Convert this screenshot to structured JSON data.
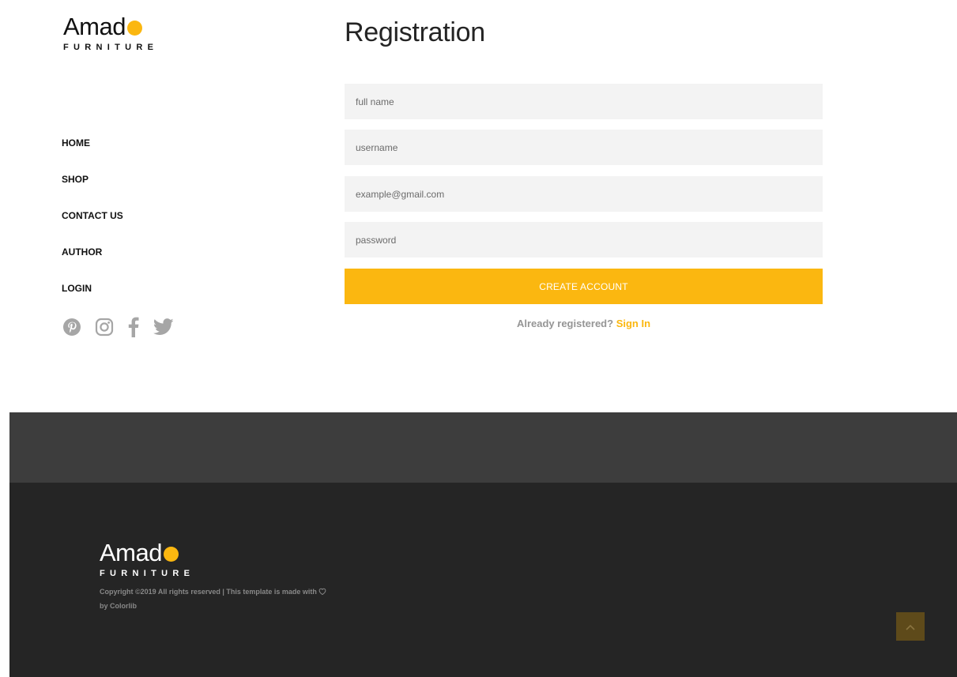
{
  "brand": {
    "name": "Amad",
    "tagline": "FURNITURE",
    "accent_color": "#fbb710"
  },
  "nav": {
    "items": [
      {
        "label": "HOME"
      },
      {
        "label": "SHOP"
      },
      {
        "label": "CONTACT US"
      },
      {
        "label": "AUTHOR"
      },
      {
        "label": "LOGIN"
      }
    ]
  },
  "social": [
    {
      "icon": "pinterest-icon"
    },
    {
      "icon": "instagram-icon"
    },
    {
      "icon": "facebook-icon"
    },
    {
      "icon": "twitter-icon"
    }
  ],
  "registration": {
    "title": "Registration",
    "full_name_placeholder": "full name",
    "username_placeholder": "username",
    "email_placeholder": "example@gmail.com",
    "password_placeholder": "password",
    "submit_label": "CREATE ACCOUNT",
    "already_text": "Already registered?",
    "sign_in_label": "Sign In"
  },
  "footer": {
    "copyright_prefix": "Copyright ©2019 All rights reserved | This template is made with",
    "copyright_suffix": "by Colorlib",
    "heart_icon": "heart-icon",
    "back_to_top_icon": "chevron-up-icon"
  }
}
